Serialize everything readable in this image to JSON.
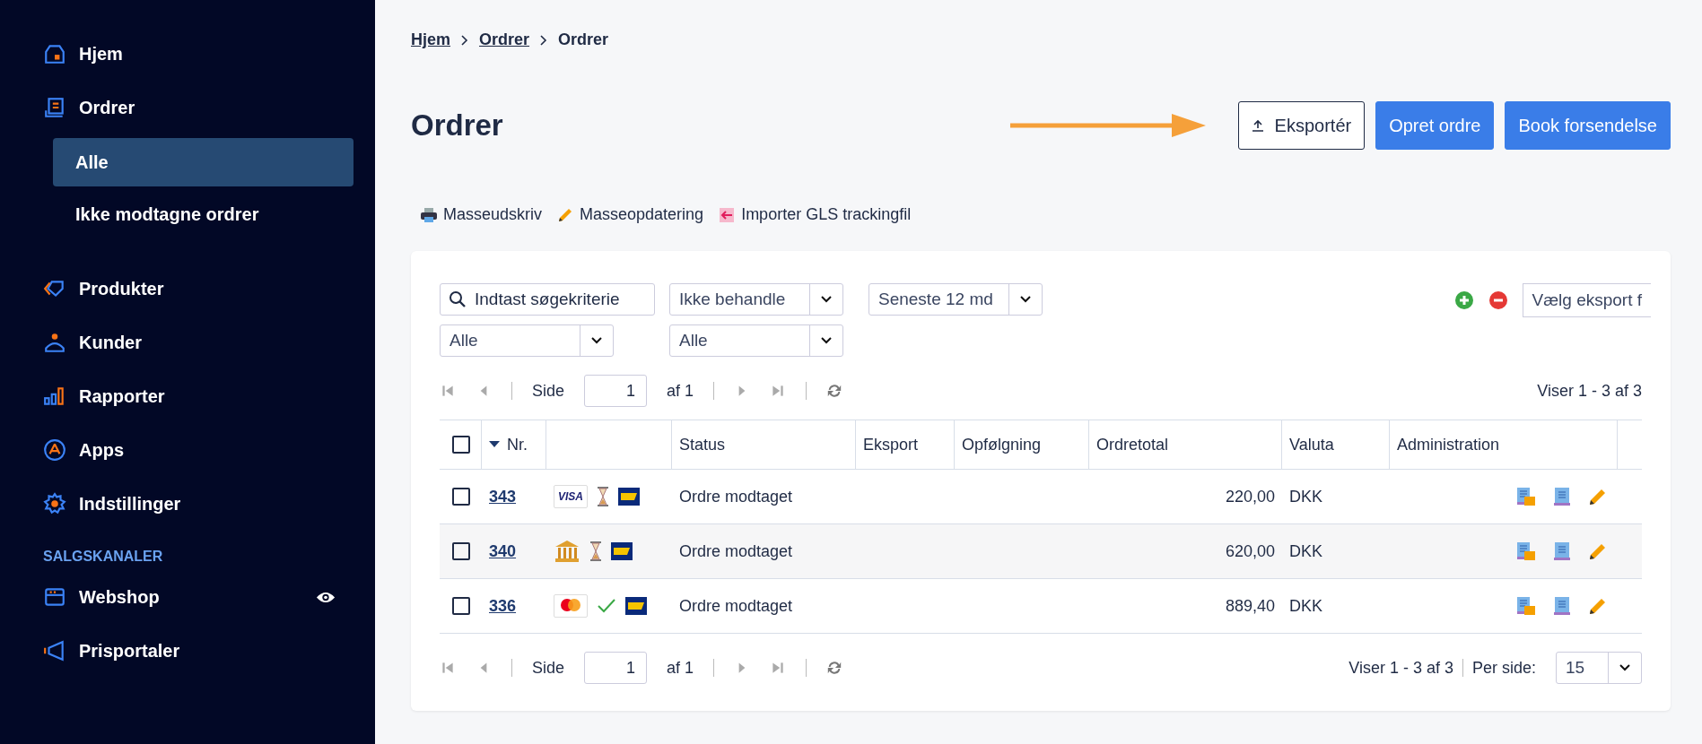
{
  "sidebar": {
    "items": [
      {
        "label": "Hjem",
        "selected": false
      },
      {
        "label": "Ordrer",
        "selected": false,
        "children": [
          {
            "label": "Alle",
            "selected": true
          },
          {
            "label": "Ikke modtagne ordrer",
            "selected": false
          }
        ]
      },
      {
        "label": "Produkter",
        "selected": false
      },
      {
        "label": "Kunder",
        "selected": false
      },
      {
        "label": "Rapporter",
        "selected": false
      },
      {
        "label": "Apps",
        "selected": false
      },
      {
        "label": "Indstillinger",
        "selected": false
      }
    ],
    "section_heading": "SALGSKANALER",
    "channels": [
      {
        "label": "Webshop",
        "eye": true
      },
      {
        "label": "Prisportaler",
        "eye": false
      }
    ]
  },
  "breadcrumbs": [
    "Hjem",
    "Ordrer",
    "Ordrer"
  ],
  "page_title": "Ordrer",
  "header_buttons": [
    {
      "label": "Eksportér",
      "kind": "outline"
    },
    {
      "label": "Opret ordre",
      "kind": "primary"
    },
    {
      "label": "Book forsendelse",
      "kind": "primary"
    }
  ],
  "toolbar": [
    "Masseudskriv",
    "Masseopdatering",
    "Importer GLS trackingfil"
  ],
  "filters": {
    "search": {
      "placeholder": "Indtast søgekriterie"
    },
    "selects_row1": [
      "Ikke behandle",
      "Seneste 12 md"
    ],
    "selects_row2": [
      "Alle",
      "Alle"
    ],
    "export_select": "Vælg eksport f"
  },
  "pager_top": {
    "page_label": "Side",
    "page": "1",
    "of": "af 1",
    "info": "Viser 1 - 3 af 3"
  },
  "table": {
    "header_checked": false,
    "columns": [
      "Nr.",
      "Status",
      "Eksport",
      "Opfølgning",
      "Ordretotal",
      "Valuta",
      "Administration"
    ],
    "rows": [
      {
        "checked": false,
        "nr": "343",
        "kind": "visa",
        "payment_label": "VISA",
        "paid": false,
        "status": "Ordre modtaget",
        "total": "220,00",
        "currency": "DKK"
      },
      {
        "checked": false,
        "nr": "340",
        "kind": "bank",
        "paid": false,
        "status": "Ordre modtaget",
        "total": "620,00",
        "currency": "DKK"
      },
      {
        "checked": false,
        "nr": "336",
        "kind": "mastercard",
        "paid": true,
        "status": "Ordre modtaget",
        "total": "889,40",
        "currency": "DKK"
      }
    ]
  },
  "pager_bottom": {
    "page_label": "Side",
    "page": "1",
    "of": "af 1",
    "info": "Viser 1 - 3 af 3",
    "per_page_label": "Per side:",
    "per_page": "15"
  }
}
